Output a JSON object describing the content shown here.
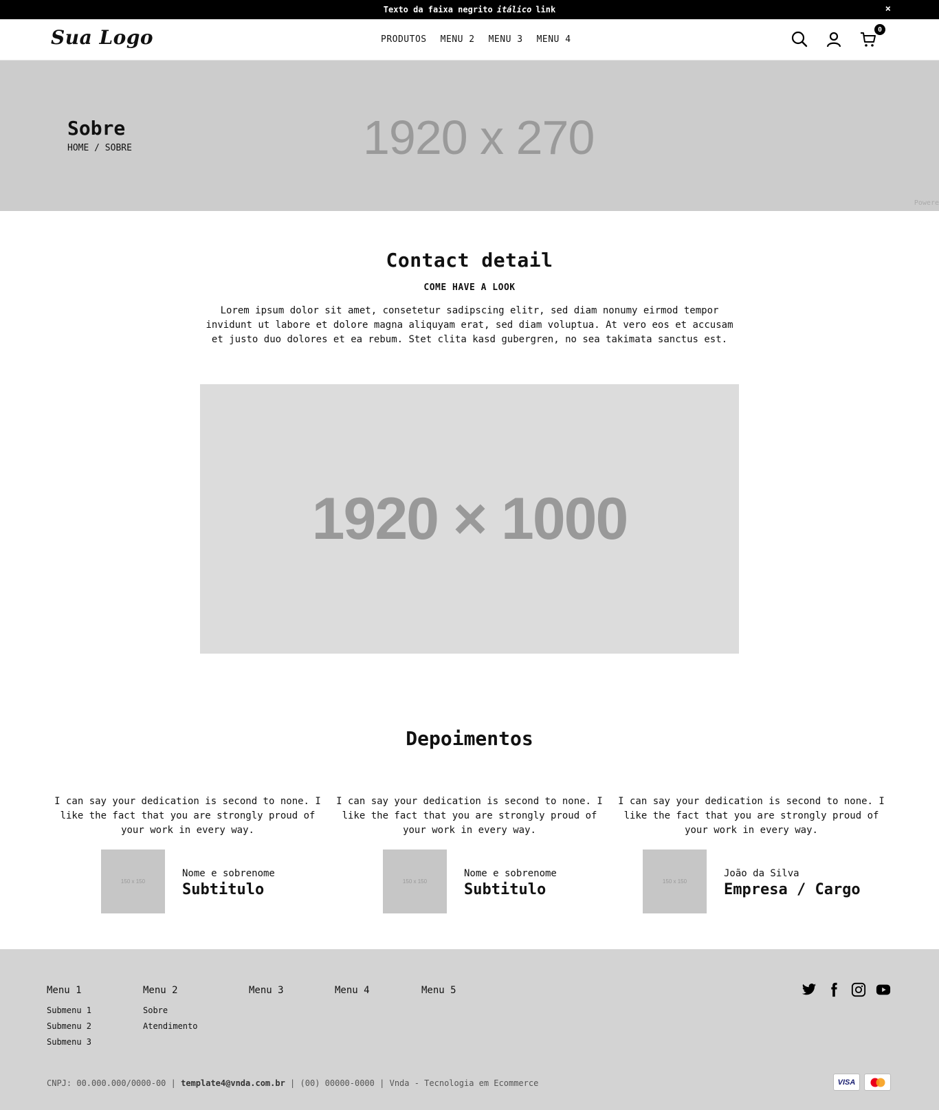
{
  "topbar": {
    "text_bold": "Texto da faixa negrito",
    "text_italic": "itálico",
    "text_link": "link",
    "close": "×"
  },
  "header": {
    "logo": "Sua Logo",
    "nav": [
      "PRODUTOS",
      "MENU 2",
      "MENU 3",
      "MENU 4"
    ],
    "cart_count": "0",
    "icons": [
      "search-icon",
      "user-icon",
      "cart-icon"
    ]
  },
  "hero": {
    "placeholder": "1920 x 270",
    "title": "Sobre",
    "breadcrumb": "HOME / SOBRE",
    "powered": "Powere"
  },
  "contact": {
    "title": "Contact detail",
    "subtitle": "COME HAVE A LOOK",
    "text": "Lorem ipsum dolor sit amet, consetetur sadipscing elitr, sed diam nonumy eirmod tempor invidunt ut labore et dolore magna aliquyam erat, sed diam voluptua. At vero eos et accusam et justo duo dolores et ea rebum. Stet clita kasd gubergren, no sea takimata sanctus est.",
    "image_placeholder": "1920 × 1000"
  },
  "testimonials": {
    "title": "Depoimentos",
    "items": [
      {
        "quote": "I can say your dedication is second to none. I like the fact that you are strongly proud of your work in every way.",
        "avatar": "150 x 150",
        "name": "Nome e sobrenome",
        "role": "Subtitulo"
      },
      {
        "quote": "I can say your dedication is second to none. I like the fact that you are strongly proud of your work in every way.",
        "avatar": "150 x 150",
        "name": "Nome e sobrenome",
        "role": "Subtitulo"
      },
      {
        "quote": "I can say your dedication is second to none. I like the fact that you are strongly proud of your work in every way.",
        "avatar": "150 x 150",
        "name": "João da Silva",
        "role": "Empresa / Cargo"
      }
    ]
  },
  "footer": {
    "columns": [
      {
        "heading": "Menu 1",
        "links": [
          "Submenu 1",
          "Submenu 2",
          "Submenu 3"
        ]
      },
      {
        "heading": "Menu 2",
        "links": [
          "Sobre",
          "Atendimento"
        ]
      },
      {
        "heading": "Menu 3",
        "links": []
      },
      {
        "heading": "Menu 4",
        "links": []
      },
      {
        "heading": "Menu 5",
        "links": []
      }
    ],
    "social": [
      "twitter-icon",
      "facebook-icon",
      "instagram-icon",
      "youtube-icon"
    ],
    "cnpj": "CNPJ: 00.000.000/0000-00",
    "email": "template4@vnda.com.br",
    "phone": "(00) 00000-0000",
    "credit": "Vnda - Tecnologia em Ecommerce",
    "sep": "|",
    "cards": [
      "VISA",
      "mastercard"
    ]
  }
}
